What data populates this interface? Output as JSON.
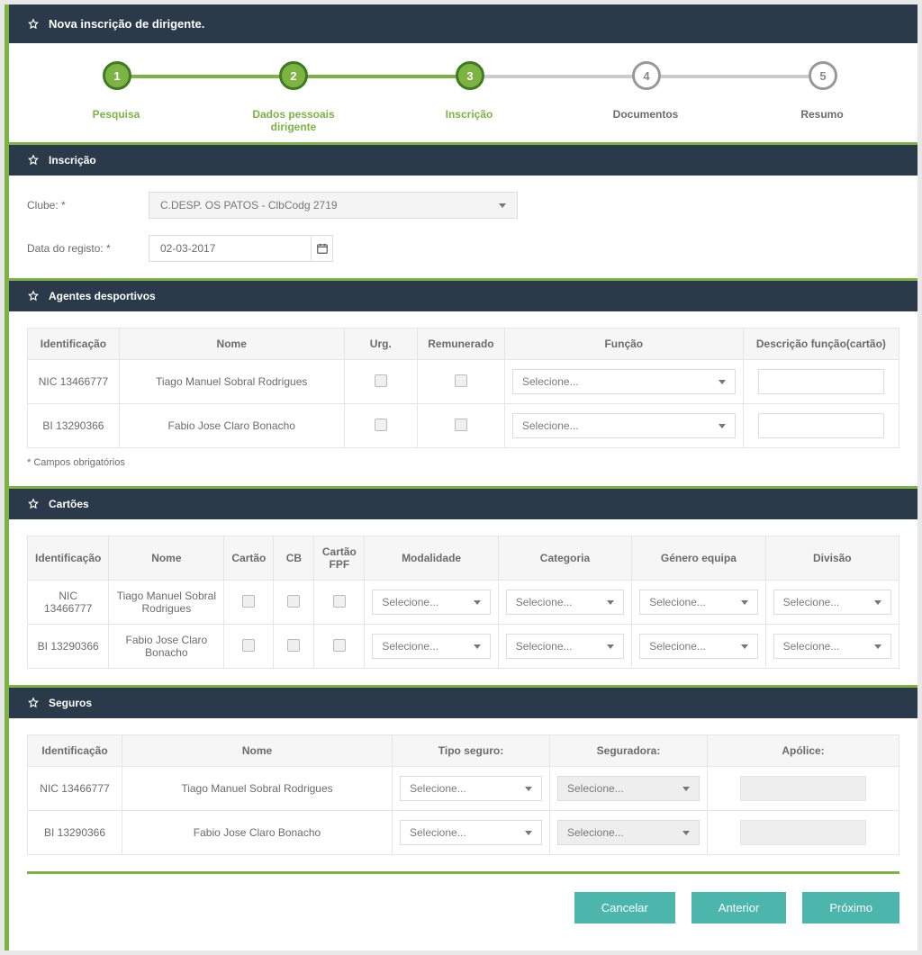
{
  "header_title": "Nova inscrição de dirigente.",
  "stepper": [
    {
      "num": "1",
      "label": "Pesquisa",
      "done": true
    },
    {
      "num": "2",
      "label": "Dados pessoais dirigente",
      "done": true
    },
    {
      "num": "3",
      "label": "Inscrição",
      "done": true
    },
    {
      "num": "4",
      "label": "Documentos",
      "done": false
    },
    {
      "num": "5",
      "label": "Resumo",
      "done": false
    }
  ],
  "inscricao": {
    "title": "Inscrição",
    "clube_label": "Clube: *",
    "clube_value": "C.DESP. OS PATOS - ClbCodg 2719",
    "data_label": "Data do registo: *",
    "data_value": "02-03-2017"
  },
  "agentes": {
    "title": "Agentes desportivos",
    "headers": {
      "id": "Identificação",
      "nome": "Nome",
      "urg": "Urg.",
      "rem": "Remunerado",
      "func": "Função",
      "desc": "Descrição função(cartão)"
    },
    "selecione": "Selecione...",
    "rows": [
      {
        "id": "NIC 13466777",
        "nome": "Tiago Manuel Sobral Rodrigues"
      },
      {
        "id": "BI 13290366",
        "nome": "Fabio Jose Claro Bonacho"
      }
    ]
  },
  "required_note": "* Campos obrigatórios",
  "cartoes": {
    "title": "Cartões",
    "headers": {
      "id": "Identificação",
      "nome": "Nome",
      "cartao": "Cartão",
      "cb": "CB",
      "cfpf": "Cartão FPF",
      "mod": "Modalidade",
      "cat": "Categoria",
      "gen": "Género equipa",
      "div": "Divisão"
    },
    "selecione": "Selecione...",
    "rows": [
      {
        "id": "NIC 13466777",
        "nome": "Tiago Manuel Sobral Rodrigues"
      },
      {
        "id": "BI 13290366",
        "nome": "Fabio Jose Claro Bonacho"
      }
    ]
  },
  "seguros": {
    "title": "Seguros",
    "headers": {
      "id": "Identificação",
      "nome": "Nome",
      "tipo": "Tipo seguro:",
      "seg": "Seguradora:",
      "apo": "Apólice:"
    },
    "selecione": "Selecione...",
    "rows": [
      {
        "id": "NIC 13466777",
        "nome": "Tiago Manuel Sobral Rodrigues"
      },
      {
        "id": "BI 13290366",
        "nome": "Fabio Jose Claro Bonacho"
      }
    ]
  },
  "buttons": {
    "cancel": "Cancelar",
    "prev": "Anterior",
    "next": "Próximo"
  }
}
